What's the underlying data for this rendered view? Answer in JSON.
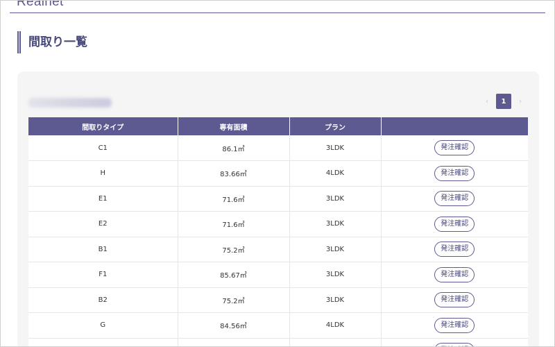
{
  "header": {
    "logo": "Realnet"
  },
  "page": {
    "title": "間取り一覧"
  },
  "pagination": {
    "prev": "‹",
    "current": "1",
    "next": "›"
  },
  "table": {
    "columns": [
      "間取りタイプ",
      "専有面積",
      "プラン",
      ""
    ],
    "button_label": "発注確認",
    "rows": [
      {
        "type": "C1",
        "area": "86.1㎡",
        "plan": "3LDK"
      },
      {
        "type": "H",
        "area": "83.66㎡",
        "plan": "4LDK"
      },
      {
        "type": "E1",
        "area": "71.6㎡",
        "plan": "3LDK"
      },
      {
        "type": "E2",
        "area": "71.6㎡",
        "plan": "3LDK"
      },
      {
        "type": "B1",
        "area": "75.2㎡",
        "plan": "3LDK"
      },
      {
        "type": "F1",
        "area": "85.67㎡",
        "plan": "3LDK"
      },
      {
        "type": "B2",
        "area": "75.2㎡",
        "plan": "3LDK"
      },
      {
        "type": "G",
        "area": "84.56㎡",
        "plan": "4LDK"
      },
      {
        "type": "",
        "area": "",
        "plan": ""
      }
    ]
  },
  "colors": {
    "accent": "#5c5a91",
    "panel_bg": "#f5f5f5"
  }
}
